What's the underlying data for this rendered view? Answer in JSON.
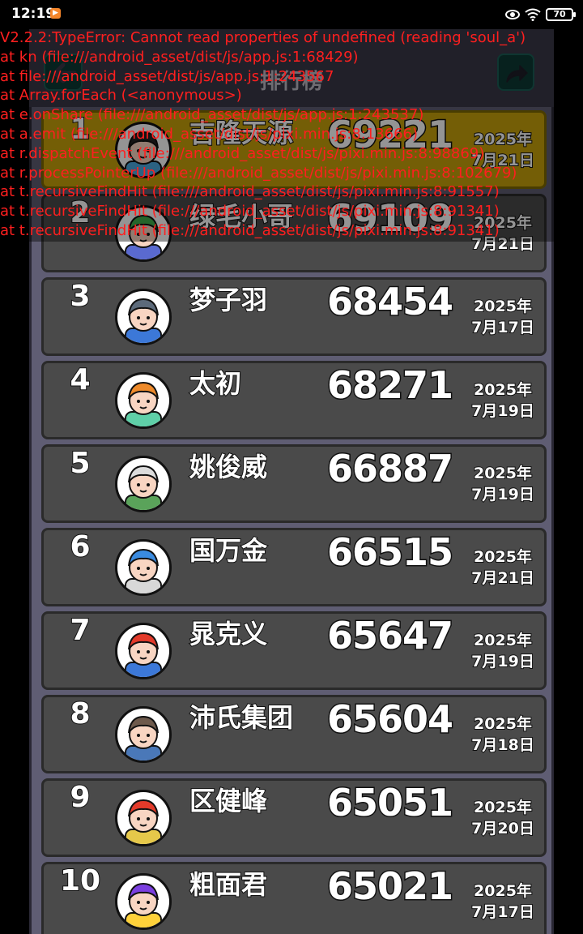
{
  "status_bar": {
    "time": "12:19",
    "battery": "70",
    "icons": [
      "app-notification-icon",
      "eye-icon",
      "wifi-icon",
      "battery-icon"
    ]
  },
  "header": {
    "title": "排行榜"
  },
  "leaderboard": [
    {
      "rank": "1",
      "name": "吉隆天源",
      "score": "69221",
      "date_year": "2025年",
      "date_md": "7月21日",
      "highlight": true
    },
    {
      "rank": "2",
      "name": "绿毛小哥",
      "score": "69109",
      "date_year": "2025年",
      "date_md": "7月21日"
    },
    {
      "rank": "3",
      "name": "梦子羽",
      "score": "68454",
      "date_year": "2025年",
      "date_md": "7月17日"
    },
    {
      "rank": "4",
      "name": "太初",
      "score": "68271",
      "date_year": "2025年",
      "date_md": "7月19日"
    },
    {
      "rank": "5",
      "name": "姚俊威",
      "score": "66887",
      "date_year": "2025年",
      "date_md": "7月19日"
    },
    {
      "rank": "6",
      "name": "国万金",
      "score": "66515",
      "date_year": "2025年",
      "date_md": "7月21日"
    },
    {
      "rank": "7",
      "name": "晁克义",
      "score": "65647",
      "date_year": "2025年",
      "date_md": "7月19日"
    },
    {
      "rank": "8",
      "name": "沛氏集团",
      "score": "65604",
      "date_year": "2025年",
      "date_md": "7月18日"
    },
    {
      "rank": "9",
      "name": "区健峰",
      "score": "65051",
      "date_year": "2025年",
      "date_md": "7月20日"
    },
    {
      "rank": "10",
      "name": "粗面君",
      "score": "65021",
      "date_year": "2025年",
      "date_md": "7月17日"
    }
  ],
  "error": {
    "lines": [
      "V2.2.2:TypeError: Cannot read properties of undefined (reading 'soul_a')",
      "at kn (file:///android_asset/dist/js/app.js:1:68429)",
      "at file:///android_asset/dist/js/app.js:1:243567",
      "at Array.forEach (<anonymous>)",
      "at e.onShare (file:///android_asset/dist/js/app.js:1:243537)",
      "at a.emit (file:///android_asset/dist/js/pixi.min.js:8:13666)",
      "at r.dispatchEvent (file:///android_asset/dist/js/pixi.min.js:8:98869)",
      "at r.processPointerUp (file:///android_asset/dist/js/pixi.min.js:8:102679)",
      "at t.recursiveFindHit (file:///android_asset/dist/js/pixi.min.js:8:91557)",
      "at t.recursiveFindHit (file:///android_asset/dist/js/pixi.min.js:8:91341)",
      "at t.recursiveFindHit (file:///android_asset/dist/js/pixi.min.js:8:91341)"
    ],
    "color": "#ff1f1f"
  },
  "colors": {
    "row_bg": "#4a4a4a",
    "first_row_bg": "#c9a30b",
    "frame_bg": "#5f5d73",
    "button_bg": "#0d3a35"
  }
}
